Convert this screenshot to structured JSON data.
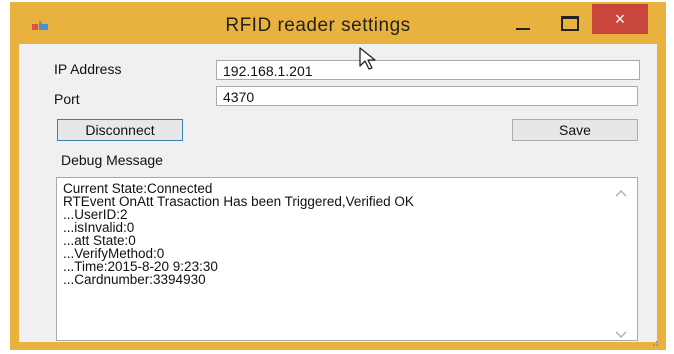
{
  "window": {
    "title": "RFID reader settings",
    "close_glyph": "×",
    "frame_color": "#e9b23e",
    "close_color": "#c9463d"
  },
  "form": {
    "ip_label": "IP Address",
    "ip_value": "192.168.1.201",
    "port_label": "Port",
    "port_value": "4370",
    "disconnect_label": "Disconnect",
    "save_label": "Save",
    "debug_label": "Debug Message"
  },
  "debug": {
    "lines": [
      "Current State:Connected",
      "RTEvent OnAtt Trasaction Has been Triggered,Verified OK",
      "...UserID:2",
      "...isInvalid:0",
      "...att State:0",
      "...VerifyMethod:0",
      "...Time:2015-8-20 9:23:30",
      "...Cardnumber:3394930"
    ]
  },
  "icons": {
    "app": "app-icon",
    "minimize": "minimize-icon",
    "maximize": "maximize-icon",
    "close": "close-icon",
    "scroll_up": "chevron-up-icon",
    "scroll_down": "chevron-down-icon",
    "cursor": "mouse-pointer-icon",
    "resize": "resize-grip-icon"
  }
}
